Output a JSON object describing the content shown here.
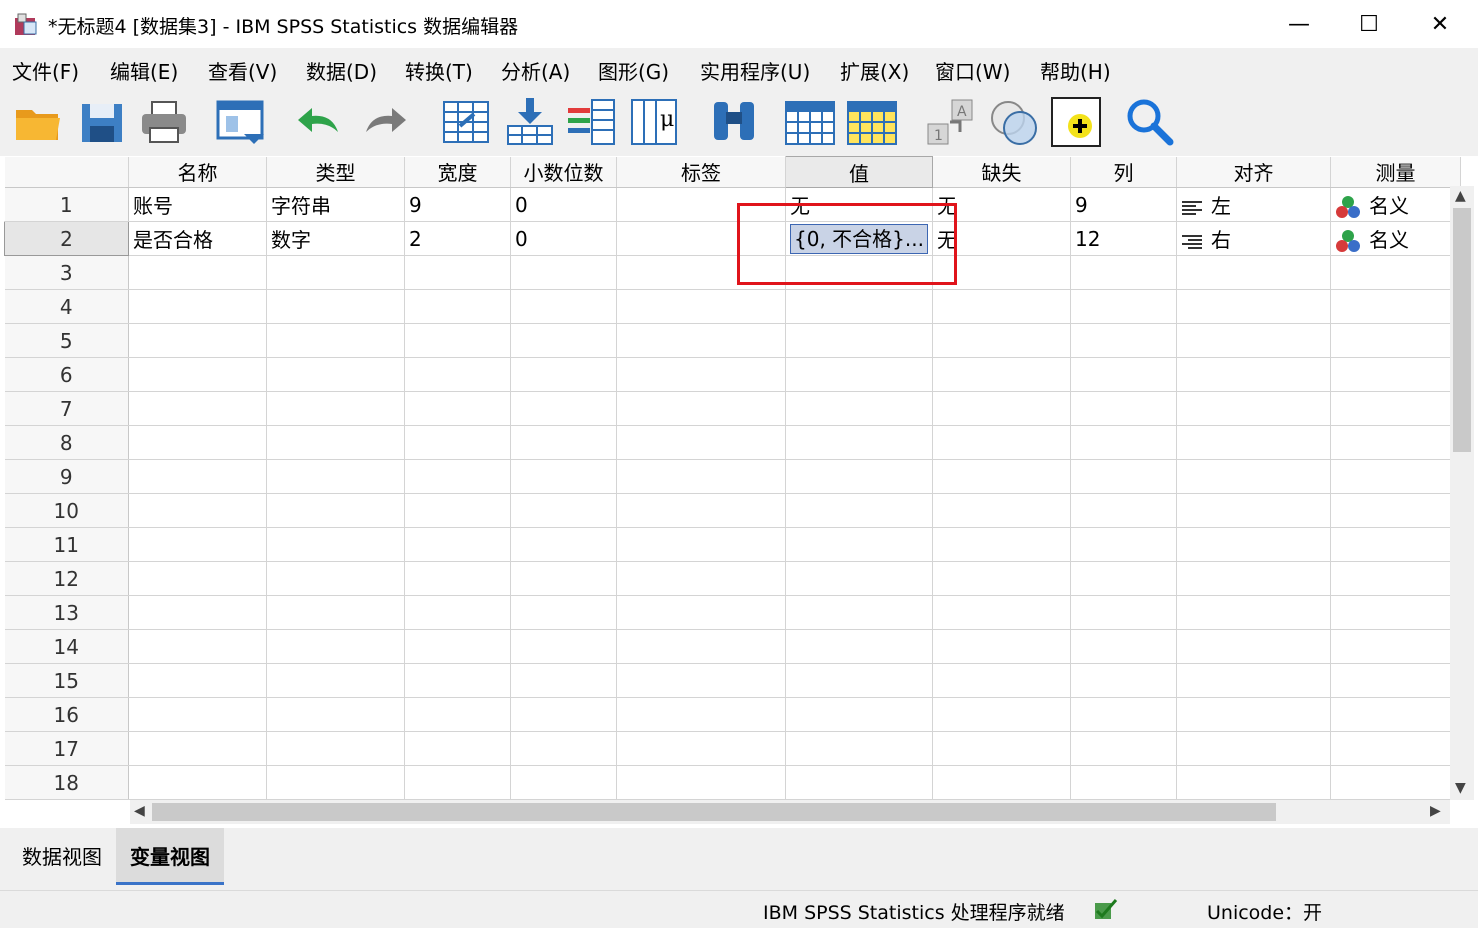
{
  "window": {
    "title": "*无标题4 [数据集3] - IBM SPSS Statistics 数据编辑器",
    "minimize": "—",
    "maximize": "☐",
    "close": "✕"
  },
  "menu": [
    "文件(F)",
    "编辑(E)",
    "查看(V)",
    "数据(D)",
    "转换(T)",
    "分析(A)",
    "图形(G)",
    "实用程序(U)",
    "扩展(X)",
    "窗口(W)",
    "帮助(H)"
  ],
  "toolbar_icons": [
    "open-folder-icon",
    "save-icon",
    "print-icon",
    "recall-dialog-icon",
    "undo-icon",
    "redo-icon",
    "goto-case-icon",
    "goto-variable-icon",
    "variables-icon",
    "run-descriptives-icon",
    "find-icon",
    "insert-cases-icon",
    "insert-variable-icon",
    "split-file-icon",
    "weight-cases-icon",
    "select-cases-icon",
    "value-labels-icon",
    "search-icon"
  ],
  "columns": [
    "名称",
    "类型",
    "宽度",
    "小数位数",
    "标签",
    "值",
    "缺失",
    "列",
    "对齐",
    "测量"
  ],
  "selected_column": "值",
  "rows": [
    {
      "num": "1",
      "name": "账号",
      "type": "字符串",
      "width": "9",
      "decimals": "0",
      "label": "",
      "values": "无",
      "missing": "无",
      "columns": "9",
      "align": "左",
      "measure": "名义"
    },
    {
      "num": "2",
      "name": "是否合格",
      "type": "数字",
      "width": "2",
      "decimals": "0",
      "label": "",
      "values": "{0, 不合格}...",
      "missing": "无",
      "columns": "12",
      "align": "右",
      "measure": "名义"
    }
  ],
  "empty_row_numbers": [
    "3",
    "4",
    "5",
    "6",
    "7",
    "8",
    "9",
    "10",
    "11",
    "12",
    "13",
    "14",
    "15",
    "16",
    "17",
    "18"
  ],
  "selected_row": "2",
  "tabs": {
    "data_view": "数据视图",
    "variable_view": "变量视图"
  },
  "active_tab": "变量视图",
  "status": {
    "processor": "IBM SPSS Statistics 处理程序就绪",
    "unicode": "Unicode：开"
  },
  "colors": {
    "highlight_box": "#e0141b",
    "selection": "#c9d3e6",
    "tab_underline": "#3a73c8"
  }
}
